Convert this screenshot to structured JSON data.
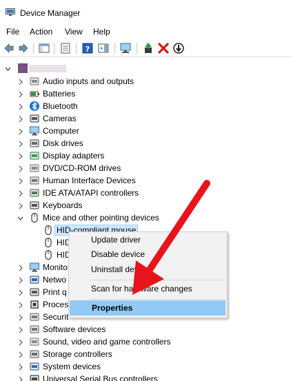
{
  "window": {
    "title": "Device Manager",
    "icon": "device-manager-icon"
  },
  "menu": [
    "File",
    "Action",
    "View",
    "Help"
  ],
  "toolbar": {
    "buttons": [
      "back-icon",
      "forward-icon",
      "show-hide-console-tree-icon",
      "properties-icon",
      "help-icon",
      "action-pane-icon",
      "computer-monitor-icon",
      "update-driver-icon",
      "uninstall-icon",
      "disable-icon"
    ]
  },
  "tree": {
    "root": "",
    "categories": [
      "Audio inputs and outputs",
      "Batteries",
      "Bluetooth",
      "Cameras",
      "Computer",
      "Disk drives",
      "Display adapters",
      "DVD/CD-ROM drives",
      "Human Interface Devices",
      "IDE ATA/ATAPI controllers",
      "Keyboards",
      "Mice and other pointing devices"
    ],
    "mice_children": [
      "HID-compliant mouse",
      "HID",
      "HID"
    ],
    "after": [
      "Monito",
      "Netwo",
      "Print q",
      "Proces",
      "Securit",
      "Software devices",
      "Sound, video and game controllers",
      "Storage controllers",
      "System devices",
      "Universal Serial Bus controllers"
    ]
  },
  "context_menu": {
    "items": [
      "Update driver",
      "Disable device",
      "Uninstall devi",
      "Scan for hardware changes",
      "Properties"
    ],
    "highlighted": "Properties"
  },
  "colors": {
    "accent_arrow": "#e8141c",
    "selection": "#91c9f7"
  }
}
